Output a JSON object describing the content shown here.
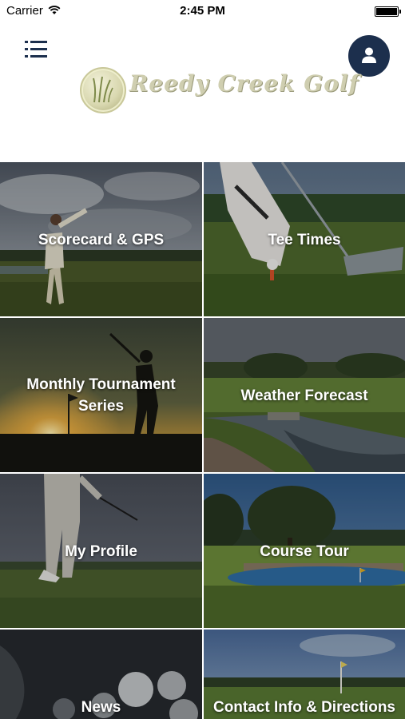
{
  "status_bar": {
    "carrier": "Carrier",
    "time": "2:45 PM"
  },
  "header": {
    "logo_text": "Reedy Creek Golf"
  },
  "tiles": [
    {
      "label": "Scorecard & GPS"
    },
    {
      "label": "Tee Times"
    },
    {
      "label": "Monthly Tournament Series"
    },
    {
      "label": "Weather Forecast"
    },
    {
      "label": "My Profile"
    },
    {
      "label": "Course Tour"
    },
    {
      "label": "News"
    },
    {
      "label": "Contact Info & Directions"
    }
  ],
  "colors": {
    "accent": "#1c2f4d",
    "logo": "#cfceb0"
  }
}
